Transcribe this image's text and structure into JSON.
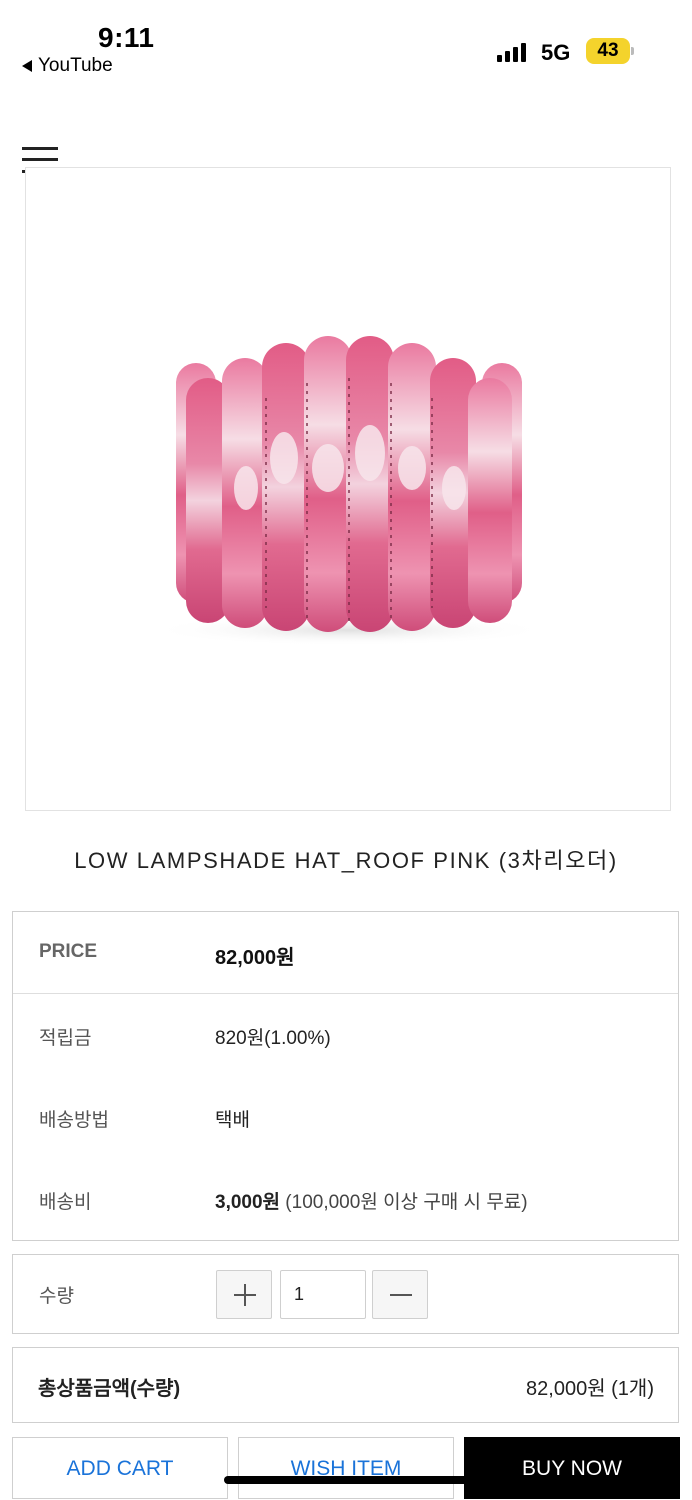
{
  "status_bar": {
    "time": "9:11",
    "back_app": "YouTube",
    "network": "5G",
    "battery": "43",
    "battery_color": "#f4d32c"
  },
  "header": {
    "menu_icon": "hamburger-menu-icon"
  },
  "product": {
    "title": "LOW LAMPSHADE HAT_ROOF PINK (3차리오더)",
    "image_subject": "pink faux fur lampshade bucket hat",
    "image_colors": {
      "main": "#e2638a",
      "dark": "#c94574",
      "light": "#f6dde5"
    }
  },
  "info": {
    "price_label": "PRICE",
    "price_value": "82,000원",
    "points_label": "적립금",
    "points_value": "820원(1.00%)",
    "shipping_method_label": "배송방법",
    "shipping_method_value": "택배",
    "shipping_fee_label": "배송비",
    "shipping_fee_value": "3,000원",
    "shipping_fee_note": " (100,000원 이상 구매 시 무료)"
  },
  "quantity": {
    "label": "수량",
    "value": "1"
  },
  "total": {
    "label": "총상품금액(수량)",
    "value": "82,000원 (1개)"
  },
  "actions": {
    "add_cart": "ADD CART",
    "wish_item": "WISH ITEM",
    "buy_now": "BUY NOW",
    "link_color": "#1a73d9"
  }
}
